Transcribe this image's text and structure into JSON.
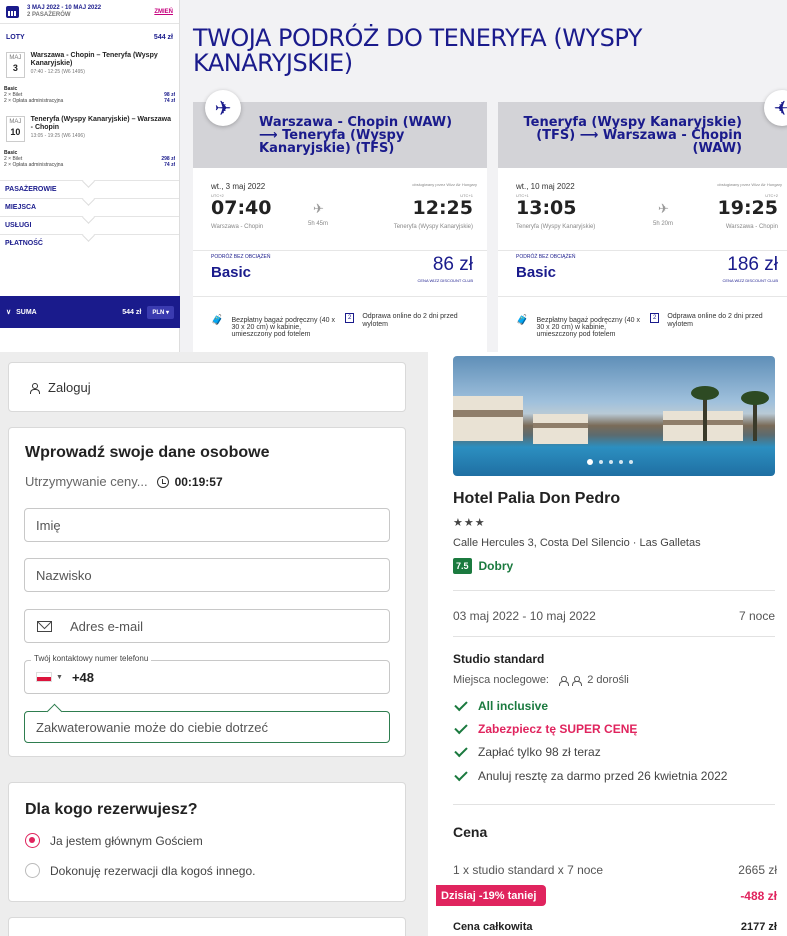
{
  "sidebar": {
    "dates": "3 MAJ 2022 - 10 MAJ 2022",
    "passengers": "2 PASAŻERÓW",
    "change_label": "ZMIEŃ",
    "flights_label": "LOTY",
    "flights_total": "544 zł",
    "outbound": {
      "month": "MAJ",
      "day": "3",
      "route": "Warszawa - Chopin – Teneryfa (Wyspy Kanaryjskie)",
      "time": "07:40 - 12:25 (W6 1495)"
    },
    "outbound_fare": {
      "type": "Basic",
      "line1": "2 × Bilet",
      "line1_price": "98 zł",
      "line2": "2 × Opłata administracyjna",
      "line2_price": "74 zł"
    },
    "inbound": {
      "month": "MAJ",
      "day": "10",
      "route": "Teneryfa (Wyspy Kanaryjskie) – Warszawa - Chopin",
      "time": "13:05 - 19:25 (W6 1496)"
    },
    "inbound_fare": {
      "type": "Basic",
      "line1": "2 × Bilet",
      "line1_price": "298 zł",
      "line2": "2 × Opłata administracyjna",
      "line2_price": "74 zł"
    },
    "sections": [
      "PASAŻEROWIE",
      "MIEJSCA",
      "USŁUGI",
      "PŁATNOŚĆ"
    ],
    "sum_label": "SUMA",
    "sum_value": "544 zł",
    "currency": "PLN"
  },
  "flights": {
    "title": "TWOJA PODRÓŻ DO TENERYFA (WYSPY KANARYJSKIE)",
    "outbound": {
      "header": "Warszawa - Chopin (WAW) ⟶ Teneryfa (Wyspy Kanaryjskie) (TFS)",
      "date": "wt., 3 maj 2022",
      "operator": "obsługiwany przez Wizz Air Hungary",
      "utc_dep": "UTC+2",
      "utc_arr": "UTC+1",
      "dep_time": "07:40",
      "arr_time": "12:25",
      "duration": "5h 45m",
      "dep_city": "Warszawa - Chopin",
      "arr_city": "Teneryfa (Wyspy Kanaryjskie)",
      "fare_label": "PODRÓŻ BEZ OBCIĄŻEŃ",
      "fare_name": "Basic",
      "price": "86 zł",
      "club": "CENA WIZZ DISCOUNT CLUB",
      "bag_text": "Bezpłatny bagaż podręczny (40 x 30 x 20 cm) w kabinie, umieszczony pod fotelem",
      "checkin_text": "Odprawa online do 2 dni przed wylotem"
    },
    "inbound": {
      "header": "Teneryfa (Wyspy Kanaryjskie) (TFS) ⟶ Warszawa - Chopin (WAW)",
      "date": "wt., 10 maj 2022",
      "operator": "obsługiwany przez Wizz Air Hungary",
      "utc_dep": "UTC+1",
      "utc_arr": "UTC+2",
      "dep_time": "13:05",
      "arr_time": "19:25",
      "duration": "5h 20m",
      "dep_city": "Teneryfa (Wyspy Kanaryjskie)",
      "arr_city": "Warszawa - Chopin",
      "fare_label": "PODRÓŻ BEZ OBCIĄŻEŃ",
      "fare_name": "Basic",
      "price": "186 zł",
      "club": "CENA WIZZ DISCOUNT CLUB",
      "bag_text": "Bezpłatny bagaż podręczny (40 x 30 x 20 cm) w kabinie, umieszczony pod fotelem",
      "checkin_text": "Odprawa online do 2 dni przed wylotem"
    }
  },
  "form": {
    "login": "Zaloguj",
    "personal_title": "Wprowadź swoje dane osobowe",
    "hold_label": "Utrzymywanie ceny...",
    "hold_timer": "00:19:57",
    "first_name_placeholder": "Imię",
    "last_name_placeholder": "Nazwisko",
    "email_placeholder": "Adres e-mail",
    "phone_label": "Twój kontaktowy numer telefonu",
    "phone_prefix": "+48",
    "accommodation_note": "Zakwaterowanie może do ciebie dotrzeć",
    "who_title": "Dla kogo rezerwujesz?",
    "option_main_guest": "Ja jestem głównym Gościem",
    "option_other": "Dokonuję rezerwacji dla kogoś innego."
  },
  "hotel": {
    "name": "Hotel Palia Don Pedro",
    "stars": "★★★",
    "address": "Calle Hercules 3, Costa Del Silencio · Las Galletas",
    "score": "7.5",
    "score_label": "Dobry",
    "dates": "03 maj 2022 - 10 maj 2022",
    "nights": "7 noce",
    "room": "Studio standard",
    "beds_label": "Miejsca noclegowe:",
    "beds_value": "2 dorośli",
    "checks": [
      "All inclusive",
      "Zabezpiecz tę SUPER CENĘ",
      "Zapłać tylko 98 zł teraz",
      "Anuluj resztę za darmo przed 26 kwietnia 2022"
    ],
    "price_title": "Cena",
    "line1_label": "1 x studio standard x 7 noce",
    "line1_value": "2665 zł",
    "discount_badge": "Dzisiaj -19% taniej",
    "discount_value": "-488 zł",
    "total_label": "Cena całkowita",
    "total_value": "2177 zł"
  },
  "colors": {
    "wizz_navy": "#1a1b8c",
    "wizz_pink": "#c6007e",
    "green": "#1b7a3f",
    "red": "#e0245e"
  }
}
